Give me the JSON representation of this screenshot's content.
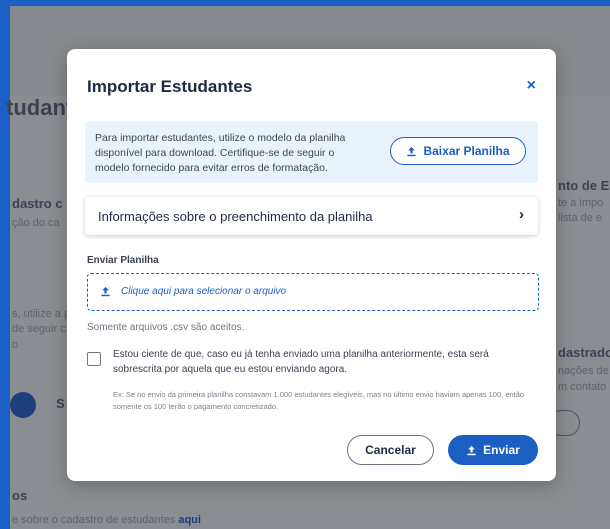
{
  "background": {
    "page_title_fragment": "tudant",
    "section_left_heading": "dastro c",
    "section_left_sub": "ção do ca",
    "left_text_1": "s, utilize a p",
    "left_text_2": "de seguir c",
    "left_text_3": "o",
    "right_heading_1": "nto de Es",
    "right_text_1": "te a impo",
    "right_text_2": "lista de e",
    "right_heading_2": "dastrado",
    "right_text_3": "nações de",
    "right_text_4": "m contato",
    "bottom_heading": "os",
    "bottom_text": "e sobre o cadastro de estudantes",
    "bottom_link": "aqui"
  },
  "modal": {
    "title": "Importar Estudantes",
    "close_symbol": "×",
    "info_text": "Para importar estudantes, utilize o modelo da planilha disponível para download. Certifique-se de seguir o modelo fornecido para evitar erros de formatação.",
    "download_label": "Baixar Planilha",
    "accordion_label": "Informações sobre o preenchimento da planilha",
    "accordion_chevron": "›",
    "upload_label": "Enviar Planilha",
    "dropzone_text": "Clique aqui para selecionar o arquivo",
    "helper_text": "Somente arquivos .csv são aceitos.",
    "consent_text": "Estou ciente de que, caso eu já tenha enviado uma planilha anteriormente, esta será sobrescrita por aquela que eu estou enviando agora.",
    "example_text": "Ex: Se no envio da primeira planilha constavam 1.000 estudantes elegíveis, mas no último envio haviam apenas 100, então somente os 100 terão o pagamento concretizado.",
    "cancel_label": "Cancelar",
    "send_label": "Enviar"
  },
  "colors": {
    "primary": "#1b5fc4",
    "overlay": "#8c8f93",
    "info_bg": "#eaf2fc"
  },
  "icons": {
    "close": "close-icon",
    "download": "upload-arrow-icon",
    "chevron": "chevron-right-icon"
  }
}
